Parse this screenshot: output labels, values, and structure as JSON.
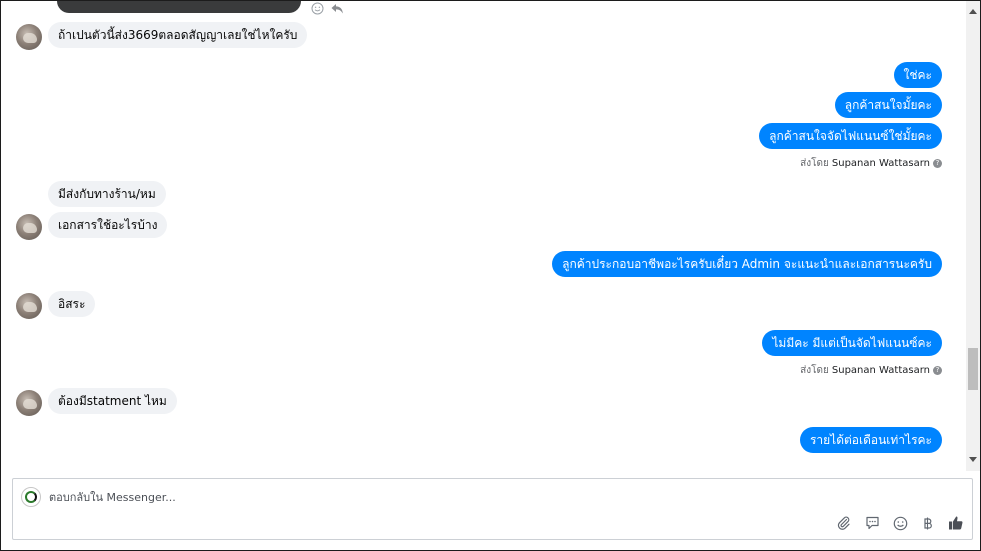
{
  "messages": [
    {
      "dir": "in",
      "avatar": true,
      "text": "ถ้าเปนตัวนี้ส่ง3669ตลอดสัญญาเลยใช่ไหใครับ"
    },
    {
      "dir": "out",
      "text": "ใช่คะ"
    },
    {
      "dir": "out",
      "text": "ลูกค้าสนใจมั้ยคะ"
    },
    {
      "dir": "out",
      "text": "ลูกค้าสนใจจัดไฟแนนซ์ใช่มั้ยคะ"
    },
    {
      "dir": "in",
      "avatar": false,
      "text": "มีส่งกับทางร้าน/หม"
    },
    {
      "dir": "in",
      "avatar": true,
      "text": "เอกสารใช้อะไรบ้าง"
    },
    {
      "dir": "out",
      "text": "ลูกค้าประกอบอาชีพอะไรครับเดี๋ยว Admin จะแนะนำและเอกสารนะครับ"
    },
    {
      "dir": "in",
      "avatar": true,
      "text": "อิสระ"
    },
    {
      "dir": "out",
      "text": "ไม่มีคะ มีแต่เป็นจัดไฟแนนซ์คะ"
    },
    {
      "dir": "in",
      "avatar": true,
      "text": "ต้องมีstatment ไหม"
    },
    {
      "dir": "out",
      "text": "รายได้ต่อเดือนเท่าไรคะ"
    }
  ],
  "sent_by": {
    "prefix": "ส่งโดย",
    "name": "Supanan Wattasarn"
  },
  "composer": {
    "placeholder": "ตอบกลับใน Messenger..."
  },
  "icons": {
    "attach": "paperclip-icon",
    "quick_reply": "chat-bubble-icon",
    "emoji": "smiley-icon",
    "currency": "baht-icon",
    "like": "thumbs-up-icon",
    "reaction": "smiley-outline-icon",
    "reply": "reply-arrow-icon",
    "help": "question-icon"
  },
  "colors": {
    "outgoing": "#0084ff",
    "incoming": "#f0f2f5",
    "like": "#4b4f56"
  }
}
